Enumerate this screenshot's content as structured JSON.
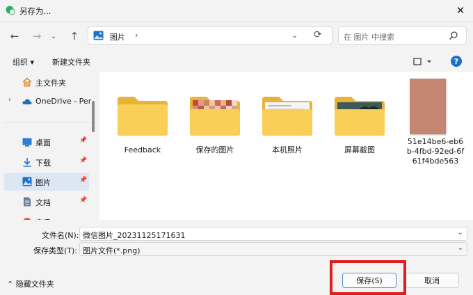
{
  "window": {
    "title": "另存为..."
  },
  "address": {
    "path_label": "图片",
    "separator": "›"
  },
  "search": {
    "placeholder": "在 图片 中搜索"
  },
  "commands": {
    "organize": "组织 ▾",
    "new_folder": "新建文件夹"
  },
  "sidebar": {
    "items": [
      {
        "label": "主文件夹"
      },
      {
        "label": "OneDrive - Per"
      },
      {
        "label": "桌面"
      },
      {
        "label": "下载"
      },
      {
        "label": "图片"
      },
      {
        "label": "文档"
      },
      {
        "label": "音乐"
      }
    ]
  },
  "files": [
    {
      "name": "Feedback"
    },
    {
      "name": "保存的图片"
    },
    {
      "name": "本机照片"
    },
    {
      "name": "屏幕截图"
    },
    {
      "name_lines": [
        "51e14be6-eb6",
        "b-4fbd-92ed-6f",
        "61f4bde563"
      ]
    }
  ],
  "form": {
    "filename_label": "文件名(N):",
    "filename_value": "微信图片_20231125171631",
    "filetype_label": "保存类型(T):",
    "filetype_value": "图片文件(*.png)"
  },
  "footer": {
    "hide_folders": "隐藏文件夹",
    "save": "保存(S)",
    "cancel": "取消"
  },
  "colors": {
    "highlight_box": "#e21b1b",
    "accent": "#1f6fc7",
    "folder": "#f7c948"
  }
}
